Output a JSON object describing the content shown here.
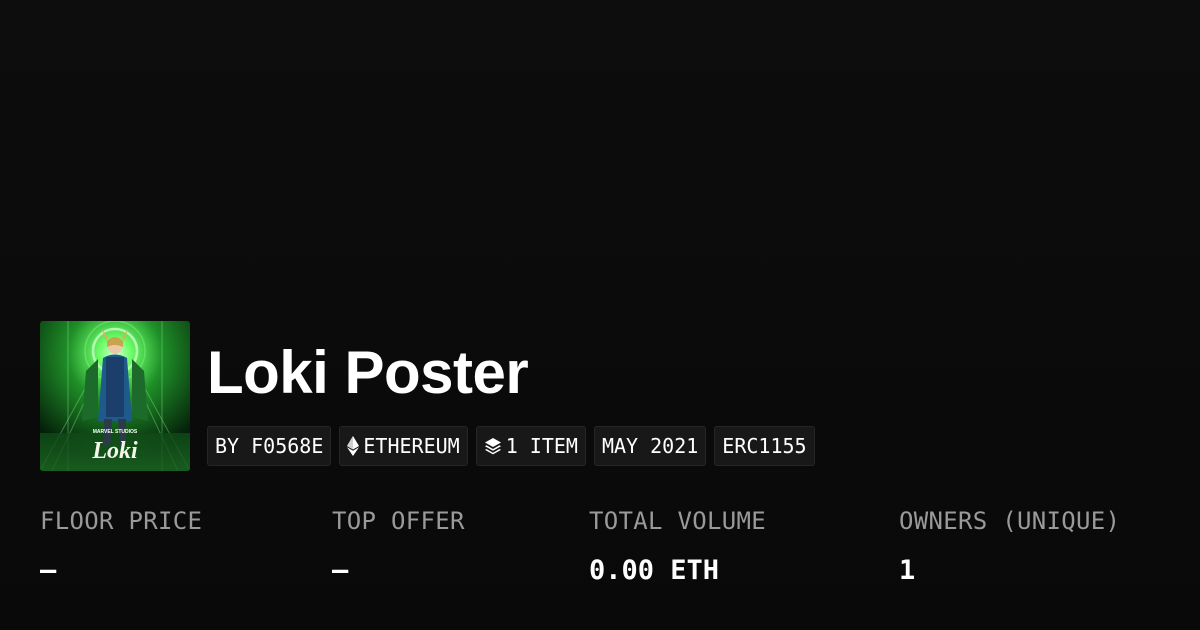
{
  "collection": {
    "name": "Loki Poster",
    "image_icon": "loki-poster-thumbnail",
    "image_caption": "MARVEL STUDIOS",
    "image_logo": "Loki",
    "badges": [
      {
        "label": "BY F0568E",
        "icon": null
      },
      {
        "label": "ETHEREUM",
        "icon": "ethereum-icon"
      },
      {
        "label": "1 ITEM",
        "icon": "layers-icon"
      },
      {
        "label": "MAY 2021",
        "icon": null
      },
      {
        "label": "ERC1155",
        "icon": null
      }
    ]
  },
  "stats": [
    {
      "label": "FLOOR PRICE",
      "value": "—"
    },
    {
      "label": "TOP OFFER",
      "value": "—"
    },
    {
      "label": "TOTAL VOLUME",
      "value": "0.00 ETH"
    },
    {
      "label": "OWNERS (UNIQUE)",
      "value": "1"
    }
  ],
  "colors": {
    "background": "#0b0b0b",
    "badge_background": "#181818",
    "label_gray": "#9a9a9a",
    "text": "#ffffff",
    "poster_green": "#3fd64a"
  }
}
